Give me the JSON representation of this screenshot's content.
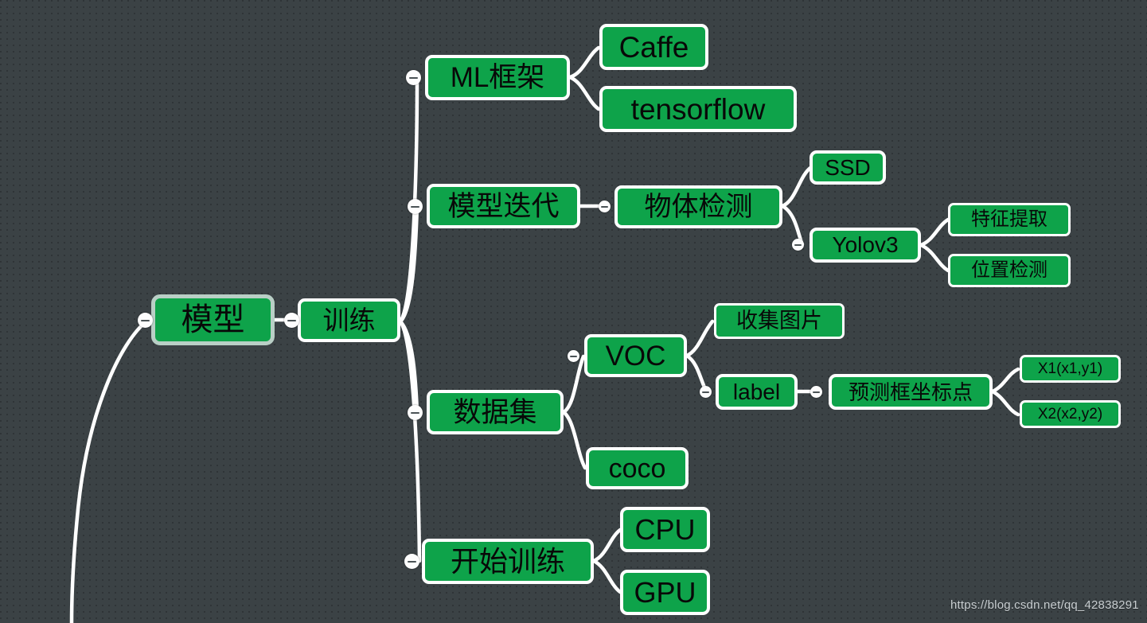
{
  "diagram": {
    "type": "mindmap",
    "title": "模型",
    "background_color": "#3b4245",
    "node_fill_color": "#0ea34a",
    "node_border_color": "#ffffff",
    "root_border_color": "#b9cfc6",
    "edge_color": "#ffffff"
  },
  "nodes": {
    "root": {
      "label": "模型"
    },
    "train": {
      "label": "训练"
    },
    "ml_framework": {
      "label": "ML框架"
    },
    "caffe": {
      "label": "Caffe"
    },
    "tensorflow": {
      "label": "tensorflow"
    },
    "model_iteration": {
      "label": "模型迭代"
    },
    "object_detection": {
      "label": "物体检测"
    },
    "ssd": {
      "label": "SSD"
    },
    "yolov3": {
      "label": "Yolov3"
    },
    "feature_extraction": {
      "label": "特征提取"
    },
    "position_detection": {
      "label": "位置检测"
    },
    "dataset": {
      "label": "数据集"
    },
    "voc": {
      "label": "VOC"
    },
    "collect_images": {
      "label": "收集图片"
    },
    "label": {
      "label": "label"
    },
    "bbox_coords": {
      "label": "预测框坐标点"
    },
    "x1": {
      "label": "X1(x1,y1)"
    },
    "x2": {
      "label": "X2(x2,y2)"
    },
    "coco": {
      "label": "coco"
    },
    "start_training": {
      "label": "开始训练"
    },
    "cpu": {
      "label": "CPU"
    },
    "gpu": {
      "label": "GPU"
    }
  },
  "handles": {
    "root_left": {
      "name": "collapse-handle-root-left"
    },
    "train_left": {
      "name": "collapse-handle-train-left"
    },
    "ml_framework_left": {
      "name": "collapse-handle-ml-framework-left"
    },
    "model_iteration_left": {
      "name": "collapse-handle-model-iteration-left"
    },
    "object_detection_left": {
      "name": "collapse-handle-object-detection-left"
    },
    "yolov3_left": {
      "name": "collapse-handle-yolov3-left"
    },
    "dataset_left": {
      "name": "collapse-handle-dataset-left"
    },
    "voc_left": {
      "name": "collapse-handle-voc-left"
    },
    "label_left": {
      "name": "collapse-handle-label-left"
    },
    "bbox_coords_left": {
      "name": "collapse-handle-bbox-coords-left"
    },
    "start_training_left": {
      "name": "collapse-handle-start-training-left"
    }
  },
  "watermark": {
    "text": "https://blog.csdn.net/qq_42838291"
  }
}
